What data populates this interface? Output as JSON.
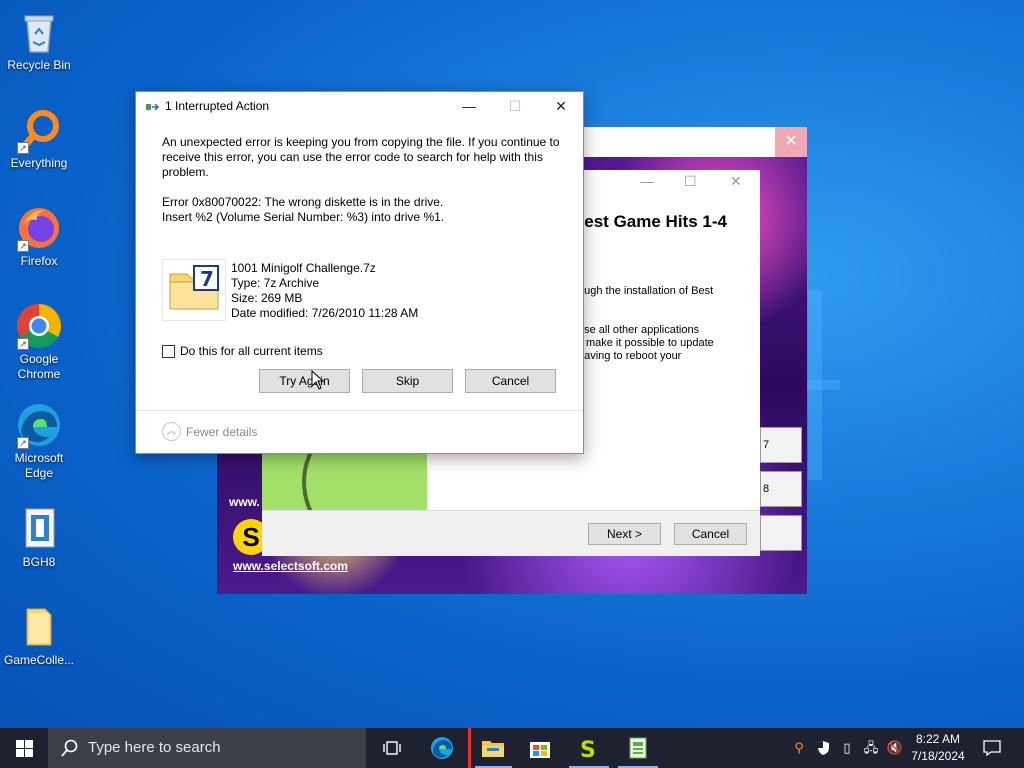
{
  "desktop": {
    "icons": [
      {
        "label": "Recycle Bin",
        "icon": "recycle-bin-icon"
      },
      {
        "label": "Everything",
        "icon": "everything-search-icon"
      },
      {
        "label": "Firefox",
        "icon": "firefox-icon"
      },
      {
        "label": "Google Chrome",
        "icon": "chrome-icon"
      },
      {
        "label": "Microsoft Edge",
        "icon": "edge-icon"
      },
      {
        "label": "BGH8",
        "icon": "bgh8-icon"
      },
      {
        "label": "GameColle...",
        "icon": "folder-icon"
      }
    ]
  },
  "installer": {
    "url_partial": "www.",
    "url": "www.selectsoft.com",
    "logo_letter": "S",
    "side_buttons": [
      "7",
      "8",
      ""
    ]
  },
  "wizard": {
    "heading": "Best Game Hits 1-4",
    "line1": "ough the installation of Best",
    "para": [
      "ose all other applications",
      "ll make it possible to update",
      "having to reboot your"
    ],
    "next_label": "Next >",
    "cancel_label": "Cancel"
  },
  "dialog": {
    "title": "1 Interrupted Action",
    "message": "An unexpected error is keeping you from copying the file. If you continue to receive this error, you can use the error code to search for help with this problem.",
    "error_line1": "Error 0x80070022: The wrong diskette is in the drive.",
    "error_line2": "Insert %2 (Volume Serial Number: %3) into drive %1.",
    "file": {
      "name": "1001 Minigolf Challenge.7z",
      "type": "Type: 7z Archive",
      "size": "Size: 269 MB",
      "modified": "Date modified: 7/26/2010 11:28 AM"
    },
    "checkbox_label": "Do this for all current items",
    "buttons": {
      "try_again": "Try Again",
      "skip": "Skip",
      "cancel": "Cancel"
    },
    "fewer_details": "Fewer details"
  },
  "taskbar": {
    "search_placeholder": "Type here to search",
    "time": "8:22 AM",
    "date": "7/18/2024"
  }
}
